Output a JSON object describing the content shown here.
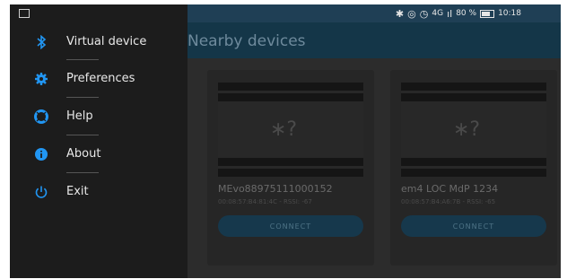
{
  "statusbar": {
    "network": "4G",
    "battery": "80 %",
    "time": "10:18"
  },
  "header": {
    "title": "Nearby devices"
  },
  "drawer": {
    "items": [
      {
        "label": "Virtual device",
        "icon": "bluetooth-icon"
      },
      {
        "label": "Preferences",
        "icon": "gear-icon"
      },
      {
        "label": "Help",
        "icon": "lifebuoy-icon"
      },
      {
        "label": "About",
        "icon": "info-icon"
      },
      {
        "label": "Exit",
        "icon": "power-icon"
      }
    ]
  },
  "devices": [
    {
      "name": "MEvo88975111000152",
      "details": "00:08:57:B4:81:4C - RSSI: -67",
      "button": "CONNECT"
    },
    {
      "name": "em4 LOC MdP 1234",
      "details": "00:08:57:B4:A6:7B - RSSI: -65",
      "button": "CONNECT"
    }
  ],
  "colors": {
    "accent": "#1e88e5",
    "header": "#143648",
    "drawer": "#1c1c1c"
  }
}
